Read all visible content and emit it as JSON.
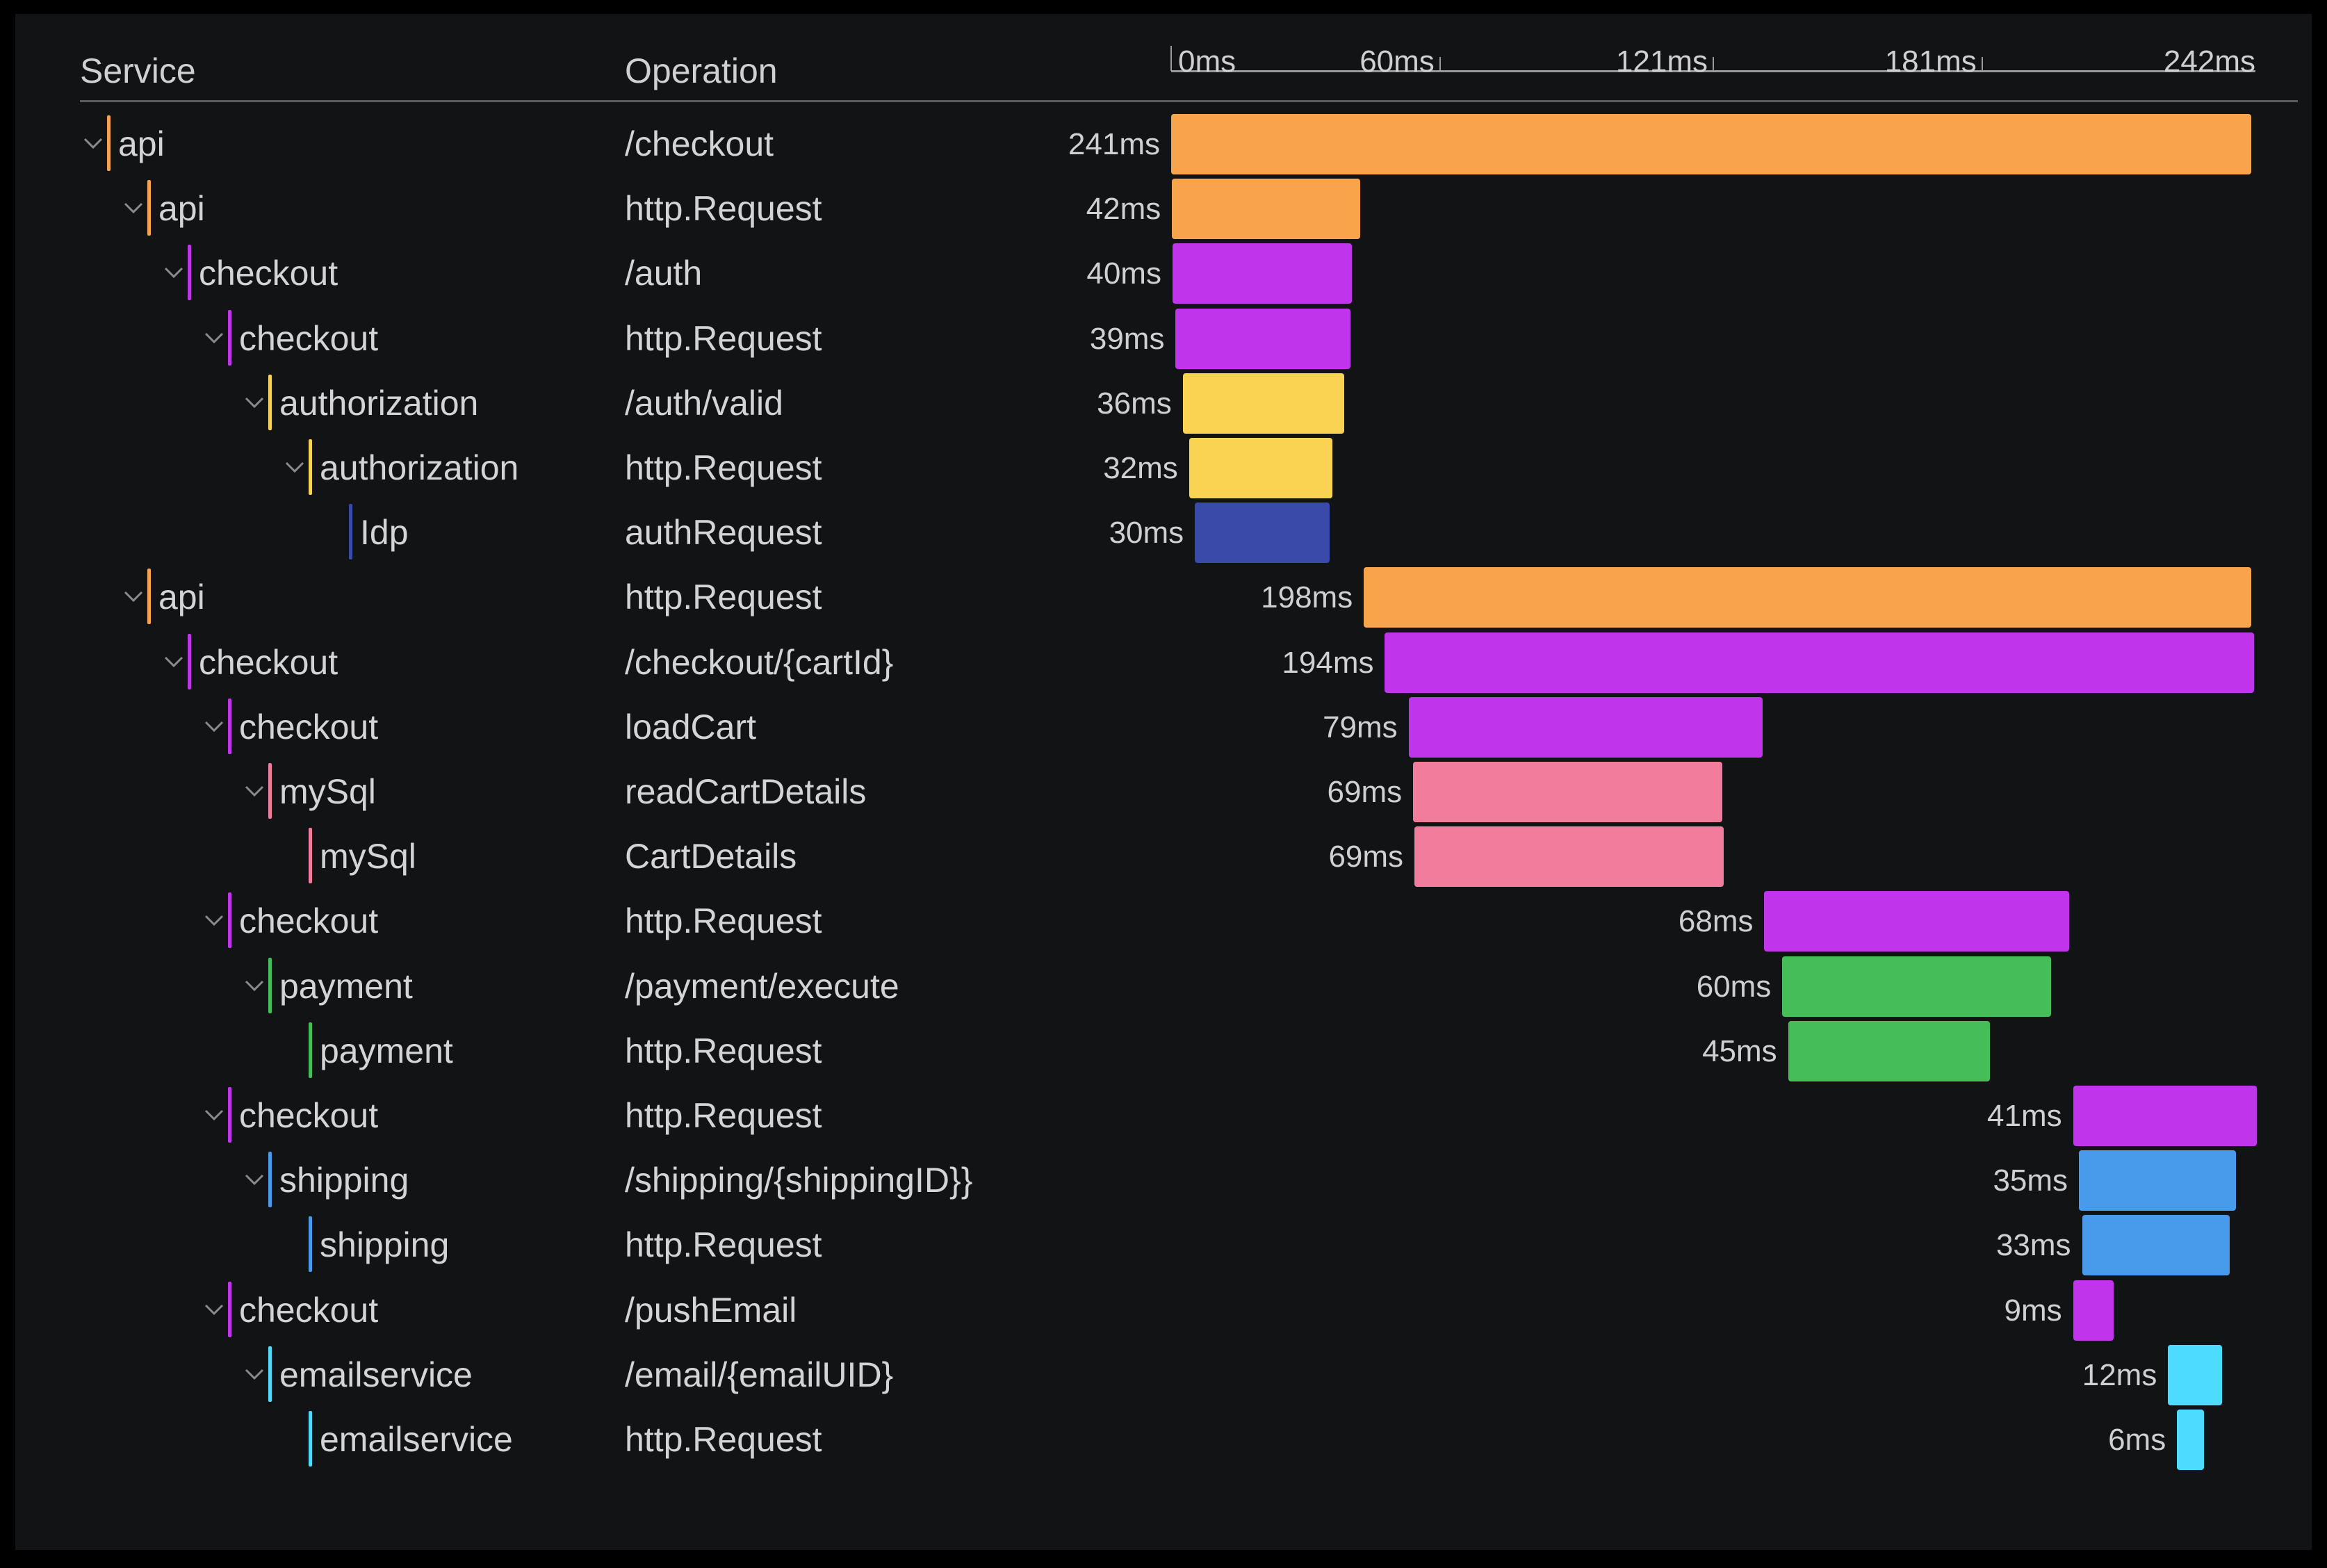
{
  "header": {
    "service": "Service",
    "operation": "Operation"
  },
  "chart_data": {
    "type": "gantt",
    "title": "",
    "xlabel": "",
    "xlim": [
      0,
      242
    ],
    "x_unit": "ms",
    "ticks": [
      {
        "value": 0,
        "label": "0ms"
      },
      {
        "value": 60,
        "label": "60ms"
      },
      {
        "value": 121,
        "label": "121ms"
      },
      {
        "value": 181,
        "label": "181ms"
      },
      {
        "value": 242,
        "label": "242ms"
      }
    ],
    "colors": {
      "api": "#f7a44a",
      "checkout": "#c035eb",
      "authorization": "#fbd352",
      "Idp": "#3a4aa8",
      "mySql": "#f27c9c",
      "payment": "#45bd59",
      "shipping": "#489aea",
      "emailservice": "#4ddcff"
    },
    "spans": [
      {
        "service": "api",
        "operation": "/checkout",
        "depth": 0,
        "collapsible": true,
        "start": 0,
        "duration": 241,
        "label": "241ms"
      },
      {
        "service": "api",
        "operation": "http.Request",
        "depth": 1,
        "collapsible": true,
        "start": 0.2,
        "duration": 42,
        "label": "42ms"
      },
      {
        "service": "checkout",
        "operation": "/auth",
        "depth": 2,
        "collapsible": true,
        "start": 0.3,
        "duration": 40,
        "label": "40ms"
      },
      {
        "service": "checkout",
        "operation": "http.Request",
        "depth": 3,
        "collapsible": true,
        "start": 1,
        "duration": 39,
        "label": "39ms"
      },
      {
        "service": "authorization",
        "operation": "/auth/valid",
        "depth": 4,
        "collapsible": true,
        "start": 2.6,
        "duration": 36,
        "label": "36ms"
      },
      {
        "service": "authorization",
        "operation": "http.Request",
        "depth": 5,
        "collapsible": true,
        "start": 4,
        "duration": 32,
        "label": "32ms"
      },
      {
        "service": "Idp",
        "operation": "authRequest",
        "depth": 6,
        "collapsible": false,
        "start": 5.3,
        "duration": 30,
        "label": "30ms"
      },
      {
        "service": "api",
        "operation": "http.Request",
        "depth": 1,
        "collapsible": true,
        "start": 43,
        "duration": 198,
        "label": "198ms"
      },
      {
        "service": "checkout",
        "operation": "/checkout/{cartId}",
        "depth": 2,
        "collapsible": true,
        "start": 47.7,
        "duration": 194,
        "label": "194ms"
      },
      {
        "service": "checkout",
        "operation": "loadCart",
        "depth": 3,
        "collapsible": true,
        "start": 53,
        "duration": 79,
        "label": "79ms"
      },
      {
        "service": "mySql",
        "operation": "readCartDetails",
        "depth": 4,
        "collapsible": true,
        "start": 54,
        "duration": 69,
        "label": "69ms"
      },
      {
        "service": "mySql",
        "operation": "CartDetails",
        "depth": 5,
        "collapsible": false,
        "start": 54.3,
        "duration": 69,
        "label": "69ms"
      },
      {
        "service": "checkout",
        "operation": "http.Request",
        "depth": 3,
        "collapsible": true,
        "start": 132.4,
        "duration": 68,
        "label": "68ms"
      },
      {
        "service": "payment",
        "operation": "/payment/execute",
        "depth": 4,
        "collapsible": true,
        "start": 136.4,
        "duration": 60,
        "label": "60ms"
      },
      {
        "service": "payment",
        "operation": "http.Request",
        "depth": 5,
        "collapsible": false,
        "start": 137.7,
        "duration": 45,
        "label": "45ms"
      },
      {
        "service": "checkout",
        "operation": "http.Request",
        "depth": 3,
        "collapsible": true,
        "start": 201.3,
        "duration": 41,
        "label": "41ms"
      },
      {
        "service": "shipping",
        "operation": "/shipping/{shippingID}}",
        "depth": 4,
        "collapsible": true,
        "start": 202.6,
        "duration": 35,
        "label": "35ms"
      },
      {
        "service": "shipping",
        "operation": "http.Request",
        "depth": 5,
        "collapsible": false,
        "start": 203.3,
        "duration": 33,
        "label": "33ms"
      },
      {
        "service": "checkout",
        "operation": "/pushEmail",
        "depth": 3,
        "collapsible": true,
        "start": 201.3,
        "duration": 9,
        "label": "9ms"
      },
      {
        "service": "emailservice",
        "operation": "/email/{emailUID}",
        "depth": 4,
        "collapsible": true,
        "start": 222.5,
        "duration": 12,
        "label": "12ms"
      },
      {
        "service": "emailservice",
        "operation": "http.Request",
        "depth": 5,
        "collapsible": false,
        "start": 224.5,
        "duration": 6,
        "label": "6ms"
      }
    ]
  }
}
